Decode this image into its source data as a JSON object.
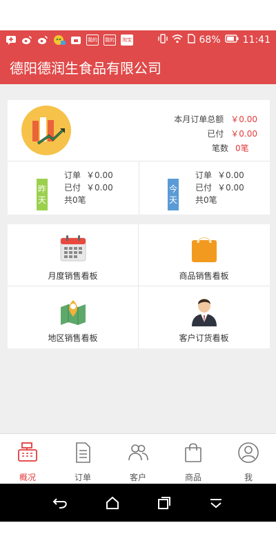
{
  "status_bar": {
    "battery": "68%",
    "time": "11:41",
    "notif_tags": [
      "我的",
      "我的",
      "淘宝"
    ]
  },
  "title_bar": {
    "title": "德阳德润生食品有限公司"
  },
  "summary": {
    "month_total_label": "本月订单总额",
    "month_total_value": "￥0.00",
    "paid_label": "已付",
    "paid_value": "￥0.00",
    "count_label": "笔数",
    "count_value": "0笔",
    "yesterday": {
      "tag_1": "昨",
      "tag_2": "天",
      "order_label": "订单",
      "order_amount": "￥0.00",
      "paid_label": "已付",
      "paid_amount": "￥0.00",
      "total": "共0笔"
    },
    "today": {
      "tag_1": "今",
      "tag_2": "天",
      "order_label": "订单",
      "order_amount": "￥0.00",
      "paid_label": "已付",
      "paid_amount": "￥0.00",
      "total": "共0笔"
    }
  },
  "boards": [
    {
      "label": "月度销售看板",
      "icon": "calendar-icon"
    },
    {
      "label": "商品销售看板",
      "icon": "shopping-bag-icon"
    },
    {
      "label": "地区销售看板",
      "icon": "map-pin-icon"
    },
    {
      "label": "客户订货看板",
      "icon": "customer-avatar-icon"
    }
  ],
  "bottom_nav": [
    {
      "label": "概况",
      "icon": "cash-register-icon",
      "active": true
    },
    {
      "label": "订单",
      "icon": "document-icon"
    },
    {
      "label": "客户",
      "icon": "people-icon"
    },
    {
      "label": "商品",
      "icon": "bag-icon"
    },
    {
      "label": "我",
      "icon": "profile-icon"
    }
  ],
  "colors": {
    "brand_red": "#e04a4a",
    "amount_red": "#e23a3a",
    "yesterday_tag": "#9bd04d",
    "today_tag": "#5b9bd5"
  }
}
